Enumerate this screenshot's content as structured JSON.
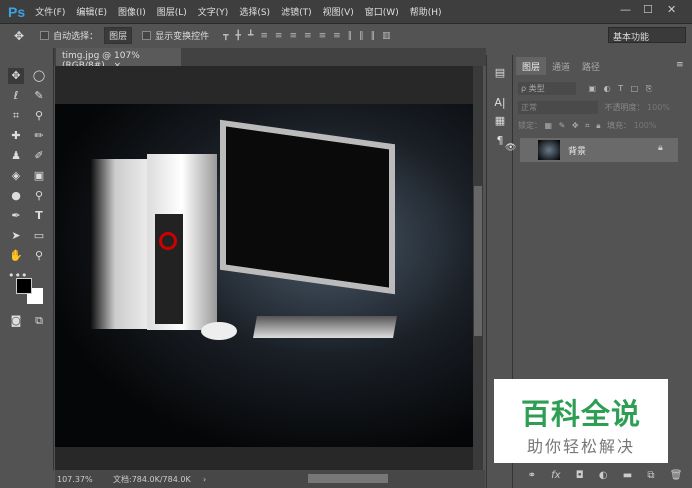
{
  "app": {
    "logo": "Ps"
  },
  "menu": [
    "文件(F)",
    "编辑(E)",
    "图像(I)",
    "图层(L)",
    "文字(Y)",
    "选择(S)",
    "滤镜(T)",
    "视图(V)",
    "窗口(W)",
    "帮助(H)"
  ],
  "window_controls": {
    "minimize": "—",
    "maximize": "☐",
    "close": "✕"
  },
  "options": {
    "auto_select_label": "自动选择：",
    "auto_select_value": "图层",
    "show_transform_label": "显示变换控件",
    "workspace": "基本功能"
  },
  "document": {
    "tab_title": "timg.jpg @ 107%(RGB/8#)",
    "tab_close": "×",
    "zoom": "107.37%",
    "doc_info": "文档:784.0K/784.0K"
  },
  "layers_panel": {
    "tabs": [
      "图层",
      "通道",
      "路径"
    ],
    "filter_kind": "ρ 类型",
    "blend_mode": "正常",
    "opacity_label": "不透明度：",
    "opacity_value": "100%",
    "lock_label": "锁定：",
    "fill_label": "填充：",
    "fill_value": "100%",
    "layers": [
      {
        "name": "背景",
        "visible": true,
        "locked": true
      }
    ]
  },
  "watermark": {
    "line1": "百科全说",
    "line2": "助你轻松解决"
  }
}
